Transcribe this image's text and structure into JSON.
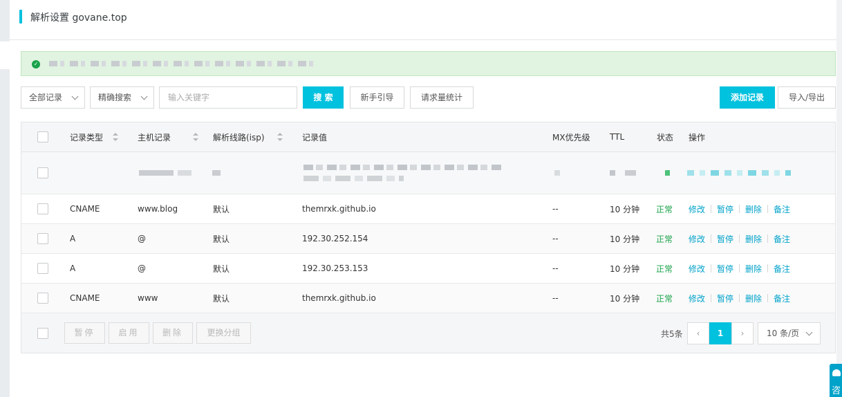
{
  "header": {
    "title": "解析设置 govane.top"
  },
  "alert": {
    "icon": "check-circle-icon",
    "message": ""
  },
  "toolbar": {
    "record_filter": "全部记录",
    "search_mode": "精确搜索",
    "search_placeholder": "输入关键字",
    "search_label": "搜 索",
    "guide_label": "新手引导",
    "stats_label": "请求量统计",
    "add_label": "添加记录",
    "import_export_label": "导入/导出"
  },
  "table": {
    "columns": [
      "记录类型",
      "主机记录",
      "解析线路(isp)",
      "记录值",
      "MX优先级",
      "TTL",
      "状态",
      "操作"
    ],
    "ops": [
      "修改",
      "暂停",
      "删除",
      "备注"
    ],
    "rows": [
      {
        "type": "CNAME",
        "host": "www.blog",
        "line": "默认",
        "value": "themrxk.github.io",
        "mx": "--",
        "ttl": "10 分钟",
        "status": "正常"
      },
      {
        "type": "A",
        "host": "@",
        "line": "默认",
        "value": "192.30.252.154",
        "mx": "--",
        "ttl": "10 分钟",
        "status": "正常"
      },
      {
        "type": "A",
        "host": "@",
        "line": "默认",
        "value": "192.30.253.153",
        "mx": "--",
        "ttl": "10 分钟",
        "status": "正常"
      },
      {
        "type": "CNAME",
        "host": "www",
        "line": "默认",
        "value": "themrxk.github.io",
        "mx": "--",
        "ttl": "10 分钟",
        "status": "正常"
      }
    ]
  },
  "footer": {
    "pause_label": "暂停",
    "enable_label": "启用",
    "delete_label": "删除",
    "regroup_label": "更换分组",
    "total": "共5条",
    "current_page": "1",
    "page_size": "10 条/页"
  },
  "consult": {
    "label": "咨"
  },
  "colors": {
    "accent": "#00c1de",
    "success": "#1aa34a",
    "link": "#00a2ca",
    "alert_bg": "#e1f3e1"
  }
}
